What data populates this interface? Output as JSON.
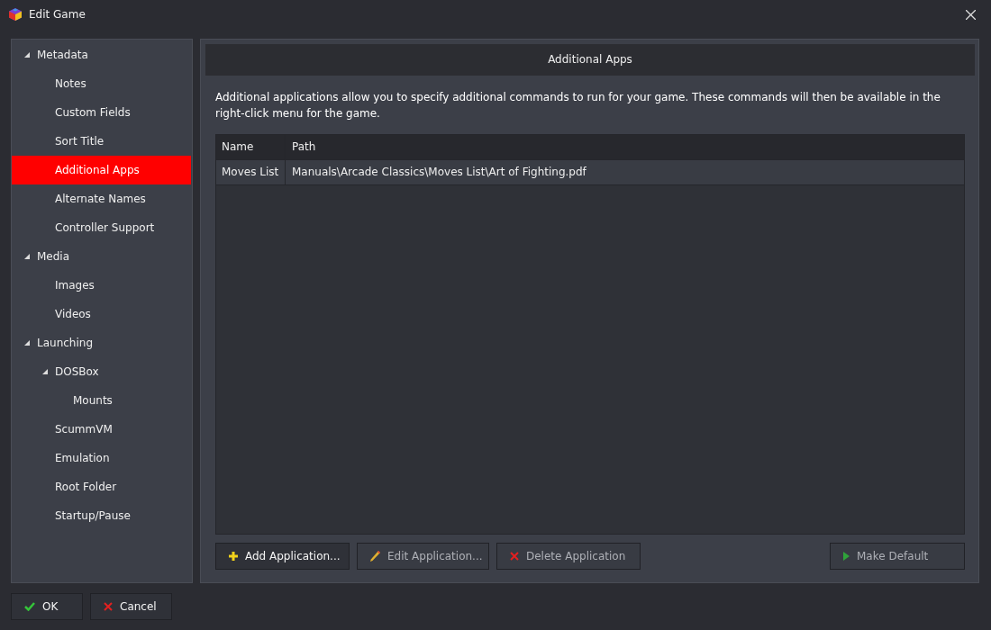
{
  "window": {
    "title": "Edit Game"
  },
  "sidebar": {
    "items": [
      {
        "label": "Metadata",
        "selected": false,
        "expanded": true,
        "children": [
          {
            "label": "Notes",
            "selected": false
          },
          {
            "label": "Custom Fields",
            "selected": false
          },
          {
            "label": "Sort Title",
            "selected": false
          },
          {
            "label": "Additional Apps",
            "selected": true
          },
          {
            "label": "Alternate Names",
            "selected": false
          },
          {
            "label": "Controller Support",
            "selected": false
          }
        ]
      },
      {
        "label": "Media",
        "selected": false,
        "expanded": true,
        "children": [
          {
            "label": "Images",
            "selected": false
          },
          {
            "label": "Videos",
            "selected": false
          }
        ]
      },
      {
        "label": "Launching",
        "selected": false,
        "expanded": true,
        "children": [
          {
            "label": "DOSBox",
            "selected": false,
            "expanded": true,
            "children": [
              {
                "label": "Mounts",
                "selected": false
              }
            ]
          },
          {
            "label": "ScummVM",
            "selected": false
          },
          {
            "label": "Emulation",
            "selected": false
          },
          {
            "label": "Root Folder",
            "selected": false
          },
          {
            "label": "Startup/Pause",
            "selected": false
          }
        ]
      }
    ]
  },
  "panel": {
    "title": "Additional Apps",
    "description": "Additional applications allow you to specify additional commands to run for your game.  These commands will then be available in the right-click menu for the game.",
    "table": {
      "columns": [
        "Name",
        "Path"
      ],
      "rows": [
        [
          "Moves List",
          "Manuals\\Arcade Classics\\Moves List\\Art of Fighting.pdf"
        ]
      ]
    },
    "buttons": [
      {
        "label": "Add Application...",
        "kind": "add",
        "disabled": false
      },
      {
        "label": "Edit Application...",
        "kind": "edit",
        "disabled": true
      },
      {
        "label": "Delete Application",
        "kind": "delete",
        "disabled": true
      },
      {
        "label": "Make Default",
        "kind": "play",
        "disabled": true
      }
    ]
  },
  "footer_buttons": [
    {
      "label": "OK",
      "kind": "ok"
    },
    {
      "label": "Cancel",
      "kind": "cancel"
    }
  ]
}
